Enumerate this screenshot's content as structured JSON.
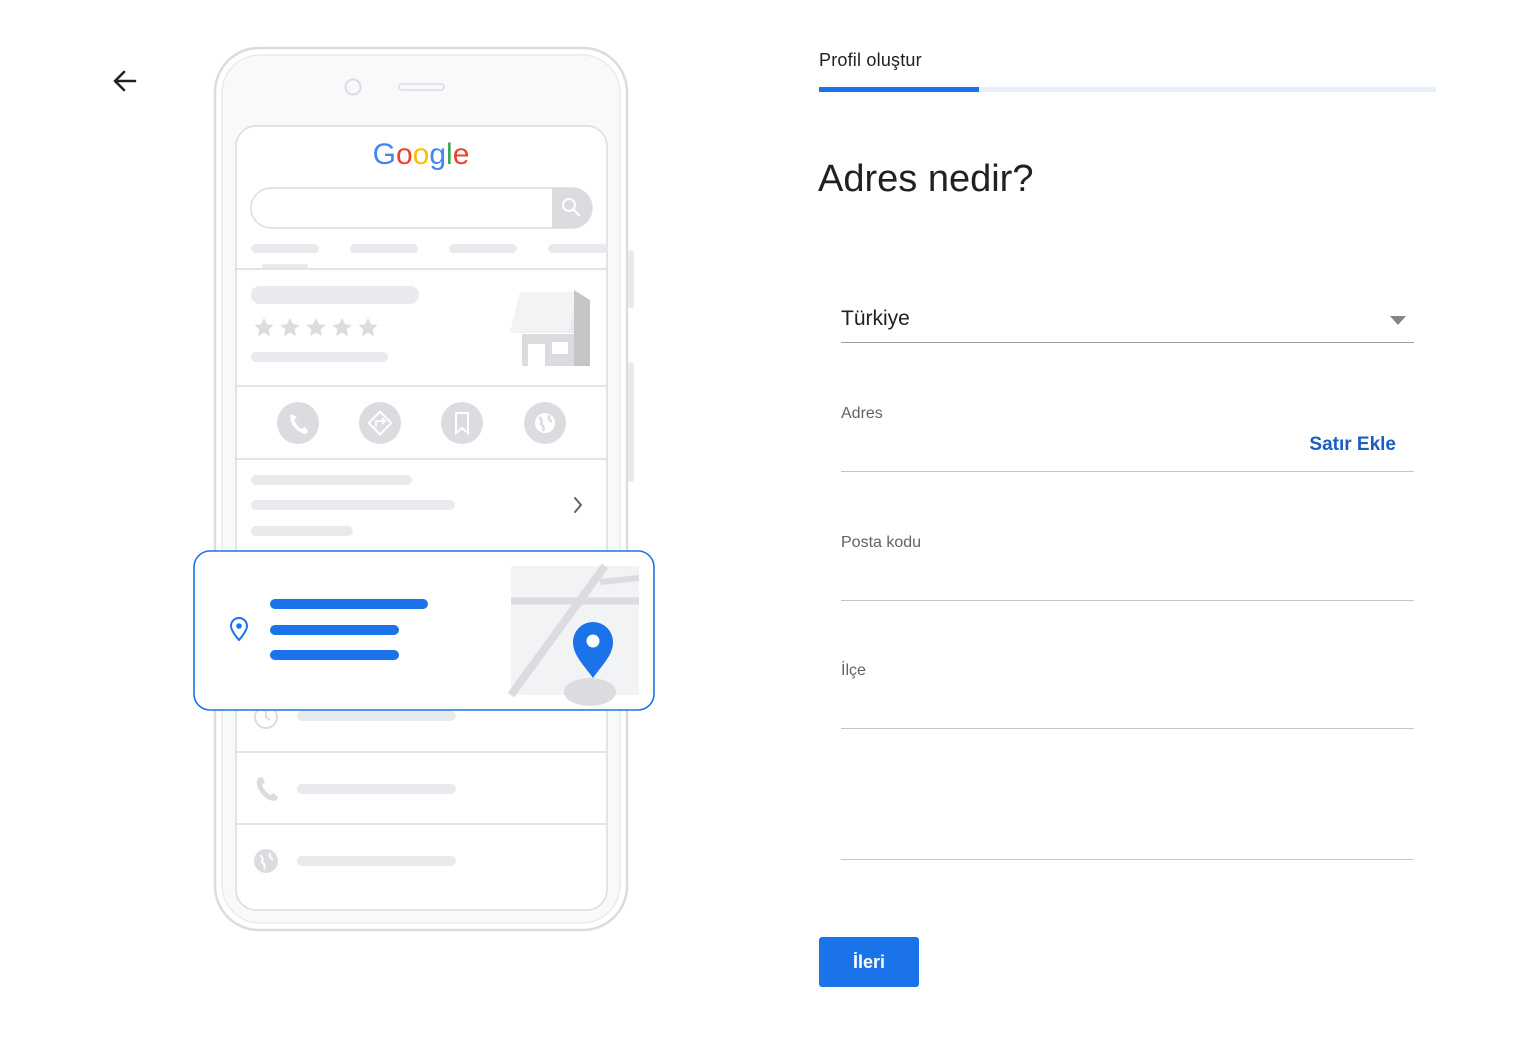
{
  "header": {
    "back_icon": "arrow-left-icon",
    "step_label": "Profil oluştur",
    "progress_fraction": 0.26
  },
  "illustration": {
    "logo_text": "Google",
    "logo_colors": [
      "#4285f4",
      "#ea4335",
      "#fbbc05",
      "#4285f4",
      "#34a853",
      "#ea4335"
    ],
    "accent": "#1a73e8",
    "icons": [
      "search-icon",
      "star-icon",
      "store-icon",
      "phone-icon",
      "directions-icon",
      "bookmark-icon",
      "globe-icon",
      "chevron-right-icon",
      "location-pin-icon",
      "map-icon",
      "clock-icon"
    ]
  },
  "form": {
    "title": "Adres nedir?",
    "country": {
      "value": "Türkiye",
      "icon": "dropdown-arrow-icon"
    },
    "address_label": "Adres",
    "add_line_label": "Satır Ekle",
    "postal_label": "Posta kodu",
    "district_label": "İlçe",
    "next_label": "İleri"
  },
  "colors": {
    "primary": "#1a73e8",
    "text": "#202124",
    "muted": "#5f6368"
  }
}
